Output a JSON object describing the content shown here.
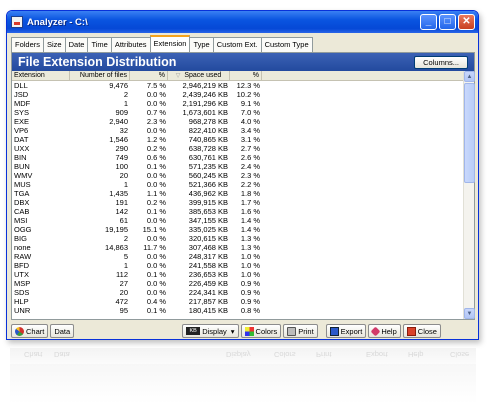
{
  "window": {
    "title": "Analyzer - C:\\"
  },
  "tabs": [
    {
      "label": "Folders"
    },
    {
      "label": "Size"
    },
    {
      "label": "Date"
    },
    {
      "label": "Time"
    },
    {
      "label": "Attributes"
    },
    {
      "label": "Extension"
    },
    {
      "label": "Type"
    },
    {
      "label": "Custom Ext."
    },
    {
      "label": "Custom Type"
    }
  ],
  "panel": {
    "title": "File Extension Distribution",
    "columns_button": "Columns..."
  },
  "table": {
    "headers": [
      "Extension",
      "Number of files",
      "%",
      "Space used",
      "%"
    ],
    "rows": [
      [
        "DLL",
        "9,476",
        "7.5 %",
        "2,946,219 KB",
        "12.3 %"
      ],
      [
        "JSD",
        "2",
        "0.0 %",
        "2,439,246 KB",
        "10.2 %"
      ],
      [
        "MDF",
        "1",
        "0.0 %",
        "2,191,296 KB",
        "9.1 %"
      ],
      [
        "SYS",
        "909",
        "0.7 %",
        "1,673,601 KB",
        "7.0 %"
      ],
      [
        "EXE",
        "2,940",
        "2.3 %",
        "968,278 KB",
        "4.0 %"
      ],
      [
        "VP6",
        "32",
        "0.0 %",
        "822,410 KB",
        "3.4 %"
      ],
      [
        "DAT",
        "1,546",
        "1.2 %",
        "740,865 KB",
        "3.1 %"
      ],
      [
        "UXX",
        "290",
        "0.2 %",
        "638,728 KB",
        "2.7 %"
      ],
      [
        "BIN",
        "749",
        "0.6 %",
        "630,761 KB",
        "2.6 %"
      ],
      [
        "BUN",
        "100",
        "0.1 %",
        "571,235 KB",
        "2.4 %"
      ],
      [
        "WMV",
        "20",
        "0.0 %",
        "560,245 KB",
        "2.3 %"
      ],
      [
        "MUS",
        "1",
        "0.0 %",
        "521,366 KB",
        "2.2 %"
      ],
      [
        "TGA",
        "1,435",
        "1.1 %",
        "436,962 KB",
        "1.8 %"
      ],
      [
        "DBX",
        "191",
        "0.2 %",
        "399,915 KB",
        "1.7 %"
      ],
      [
        "CAB",
        "142",
        "0.1 %",
        "385,653 KB",
        "1.6 %"
      ],
      [
        "MSI",
        "61",
        "0.0 %",
        "347,155 KB",
        "1.4 %"
      ],
      [
        "OGG",
        "19,195",
        "15.1 %",
        "335,025 KB",
        "1.4 %"
      ],
      [
        "BIG",
        "2",
        "0.0 %",
        "320,615 KB",
        "1.3 %"
      ],
      [
        "none",
        "14,863",
        "11.7 %",
        "307,468 KB",
        "1.3 %"
      ],
      [
        "RAW",
        "5",
        "0.0 %",
        "248,317 KB",
        "1.0 %"
      ],
      [
        "BFD",
        "1",
        "0.0 %",
        "241,558 KB",
        "1.0 %"
      ],
      [
        "UTX",
        "112",
        "0.1 %",
        "236,653 KB",
        "1.0 %"
      ],
      [
        "MSP",
        "27",
        "0.0 %",
        "226,459 KB",
        "0.9 %"
      ],
      [
        "SDS",
        "20",
        "0.0 %",
        "224,341 KB",
        "0.9 %"
      ],
      [
        "HLP",
        "472",
        "0.4 %",
        "217,857 KB",
        "0.9 %"
      ],
      [
        "UNR",
        "95",
        "0.1 %",
        "180,415 KB",
        "0.8 %"
      ]
    ]
  },
  "toolbar": {
    "chart": "Chart",
    "data": "Data",
    "display": "Display",
    "colors": "Colors",
    "print": "Print",
    "export": "Export",
    "help": "Help",
    "close": "Close",
    "kb": "KB"
  }
}
